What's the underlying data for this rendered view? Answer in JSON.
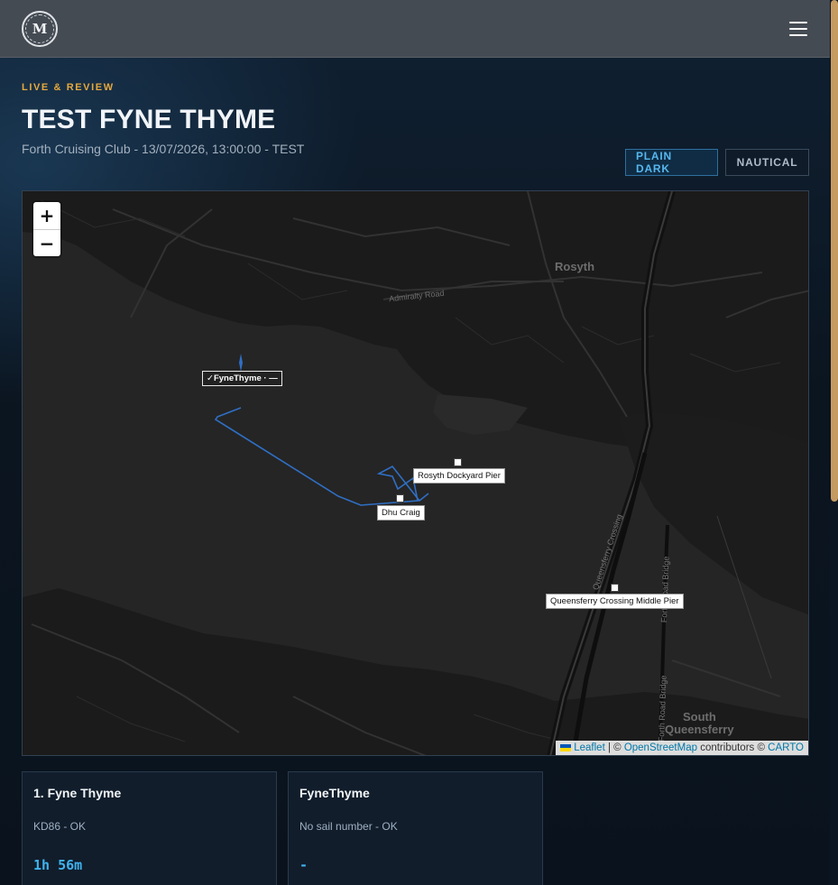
{
  "header": {
    "logo_letter": "M",
    "menu_icon": "hamburger-icon"
  },
  "page": {
    "eyebrow": "LIVE & REVIEW",
    "title": "TEST FYNE THYME",
    "subtitle": "Forth Cruising Club - 13/07/2026, 13:00:00 - TEST"
  },
  "map_style": {
    "options": [
      "PLAIN DARK",
      "NAUTICAL"
    ],
    "selected": "PLAIN DARK"
  },
  "map": {
    "zoom_in": "+",
    "zoom_out": "−",
    "places": {
      "rosyth": "Rosyth",
      "admiralty_road": "Admiralty Road",
      "queensferry_crossing_road": "Queensferry Crossing",
      "forth_road_bridge_1": "Forth Road Bridge",
      "forth_road_bridge_2": "Forth Road Bridge",
      "south": "South",
      "queensferry": "Queensferry"
    },
    "boat_label": "✓FyneThyme · —",
    "marks": {
      "rosyth_pier": "Rosyth Dockyard Pier",
      "dhu_craig": "Dhu Craig",
      "queensferry_pier": "Queensferry Crossing Middle Pier"
    },
    "attribution": {
      "leaflet": "Leaflet",
      "separator": " | © ",
      "osm": "OpenStreetMap",
      "contributors": " contributors © ",
      "carto": "CARTO"
    },
    "colors": {
      "water": "#252525",
      "land": "#1a1a1a",
      "track": "#2f6fc4",
      "accent": "#56b7ee",
      "eyebrow": "#e6a93d"
    }
  },
  "boats": [
    {
      "title": "1. Fyne Thyme",
      "sub": "KD86 - OK",
      "time": "1h 56m"
    },
    {
      "title": "FyneThyme",
      "sub": "No sail number - OK",
      "time": "-"
    }
  ]
}
